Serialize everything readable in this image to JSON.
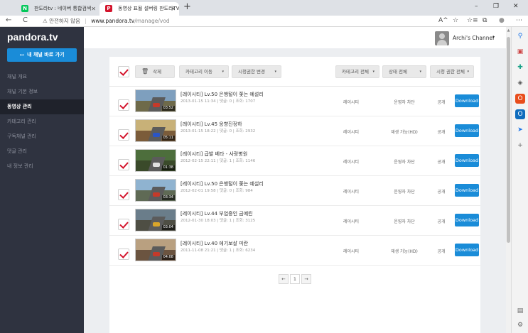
{
  "browser": {
    "tabs": [
      {
        "title": "판도라tv : 네이버 통합검색",
        "close": "✕",
        "favicon_letter": "N",
        "favicon_color": "#03c75a"
      },
      {
        "title": "동영상 표될 설버링 판도라TV",
        "close": "✕",
        "favicon_letter": "P",
        "favicon_color": "#d3142c"
      }
    ],
    "newtab": "+",
    "window_controls": [
      "–",
      "❐",
      "✕"
    ],
    "nav": {
      "back": "←",
      "reload": "C"
    },
    "address": {
      "warning": "⚠ 안전하지 않음",
      "separator": "|",
      "host": "www.pandora.tv",
      "path": "/manage/vod"
    },
    "toolbar_icons": [
      "A^",
      "☆",
      "☆≡",
      "⧉",
      "●",
      "⋯"
    ],
    "edge_sidebar_icons": [
      "search",
      "bag",
      "tools",
      "office",
      "outlook",
      "send",
      "plus"
    ]
  },
  "sidebar": {
    "logo": "pandora.tv",
    "go_button": "내 채널 바로 가기",
    "items": [
      {
        "label": "채널 개요"
      },
      {
        "label": "채널 기본 정보"
      },
      {
        "label": "동영상 관리",
        "active": true
      },
      {
        "label": "카테고리 관리"
      },
      {
        "label": "구독채널 관리"
      },
      {
        "label": "댓글 관리"
      },
      {
        "label": "내 정보 관리"
      }
    ]
  },
  "header": {
    "channel_name": "Archi's Channel",
    "caret": "▾"
  },
  "toolbar": {
    "delete": "삭제",
    "category_move": "카테고리 이동",
    "view_permission": "시청권한 변경",
    "filter_category": "카테고리 전체",
    "filter_status": "상태 전체",
    "filter_permission": "시청 권한 전체",
    "caret": "▾"
  },
  "videos": [
    {
      "title": "[레이시티] Lv.50 은행털이 쫓는 예설리",
      "meta": "2013-01-15 11:34  |  댓글: 0  |  조회: 1707",
      "duration": "03:52",
      "category": "레이시티",
      "status": "운영자 차단",
      "visibility": "공개",
      "download": "Download"
    },
    {
      "title": "[레이시티] Lv.45 응향진정하",
      "meta": "2013-01-15 18:22  |  댓글: 0  |  조회: 2932",
      "duration": "05:11",
      "category": "레이시티",
      "status": "재생 가능(HD)",
      "visibility": "공개",
      "download": "Download"
    },
    {
      "title": "[레이시티] 급발 베타 - 사랑병원",
      "meta": "2012-02-15 22:11  |  댓글: 1  |  조회: 1146",
      "duration": "01:38",
      "category": "레이시티",
      "status": "운영자 차단",
      "visibility": "공개",
      "download": "Download"
    },
    {
      "title": "[레이시티] Lv.50 은행털이 쫓는 예설리",
      "meta": "2012-02-01 19:58  |  댓글: 0  |  조회: 984",
      "duration": "03:34",
      "category": "레이시티",
      "status": "운영자 차단",
      "visibility": "공개",
      "download": "Download"
    },
    {
      "title": "[레이시티] Lv.44 부업중인 금예린",
      "meta": "2012-01-30 18:03  |  댓글: 1  |  조회: 3125",
      "duration": "03:04",
      "category": "레이시티",
      "status": "운영자 차단",
      "visibility": "공개",
      "download": "Download"
    },
    {
      "title": "[레이시티] Lv.40 에기보살 미란",
      "meta": "2011-11-08 21:21  |  댓글: 1  |  조회: 6234",
      "duration": "04:08",
      "category": "레이시티",
      "status": "재생 가능(HD)",
      "visibility": "공개",
      "download": "Download"
    }
  ],
  "pagination": {
    "prev": "←",
    "current": "1",
    "next": "→"
  },
  "colors": {
    "accent": "#1a8cd8",
    "check": "#d3142c",
    "sidebar_bg": "#2f3340"
  }
}
